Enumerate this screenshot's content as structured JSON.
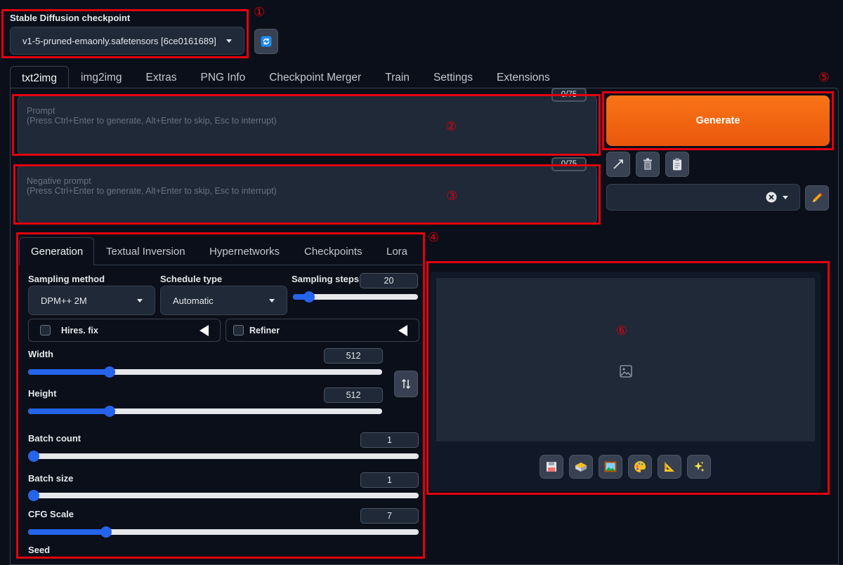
{
  "checkpoint": {
    "label": "Stable Diffusion checkpoint",
    "value": "v1-5-pruned-emaonly.safetensors [6ce0161689]"
  },
  "tabs": [
    "txt2img",
    "img2img",
    "Extras",
    "PNG Info",
    "Checkpoint Merger",
    "Train",
    "Settings",
    "Extensions"
  ],
  "prompt": {
    "placeholder_line1": "Prompt",
    "placeholder_line2": "(Press Ctrl+Enter to generate, Alt+Enter to skip, Esc to interrupt)",
    "token_count": "0/75"
  },
  "negative_prompt": {
    "placeholder_line1": "Negative prompt",
    "placeholder_line2": "(Press Ctrl+Enter to generate, Alt+Enter to skip, Esc to interrupt)",
    "token_count": "0/75"
  },
  "generate_label": "Generate",
  "subtabs": [
    "Generation",
    "Textual Inversion",
    "Hypernetworks",
    "Checkpoints",
    "Lora"
  ],
  "generation": {
    "sampling_method": {
      "label": "Sampling method",
      "value": "DPM++ 2M"
    },
    "schedule_type": {
      "label": "Schedule type",
      "value": "Automatic"
    },
    "sampling_steps": {
      "label": "Sampling steps",
      "value": "20",
      "fraction": 0.13
    },
    "hires_fix": {
      "label": "Hires. fix"
    },
    "refiner": {
      "label": "Refiner"
    },
    "width": {
      "label": "Width",
      "value": "512",
      "fraction": 0.23
    },
    "height": {
      "label": "Height",
      "value": "512",
      "fraction": 0.23
    },
    "batch_count": {
      "label": "Batch count",
      "value": "1",
      "fraction": 0.0
    },
    "batch_size": {
      "label": "Batch size",
      "value": "1",
      "fraction": 0.0
    },
    "cfg_scale": {
      "label": "CFG Scale",
      "value": "7",
      "fraction": 0.2
    },
    "seed": {
      "label": "Seed"
    }
  },
  "annotations": [
    "①",
    "②",
    "③",
    "④",
    "⑤",
    "⑥"
  ],
  "colors": {
    "accent": "#2563eb",
    "generate": "#f97316",
    "highlight": "#e3000f"
  }
}
